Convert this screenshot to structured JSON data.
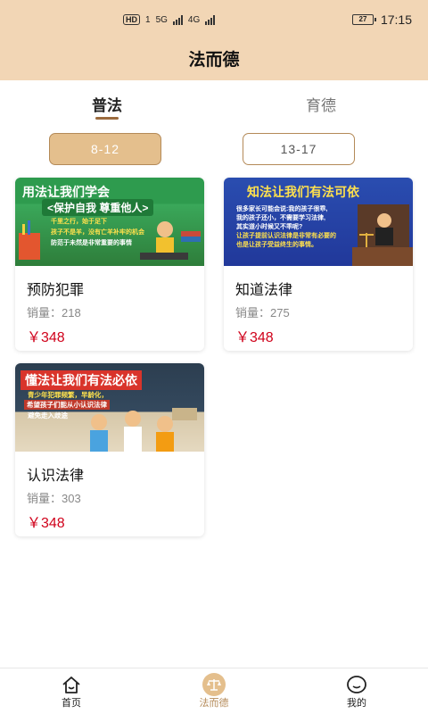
{
  "status": {
    "time": "17:15",
    "battery": "27",
    "hd": "HD",
    "sim": "1",
    "net1": "5G",
    "net2": "4G"
  },
  "header": {
    "title": "法而德"
  },
  "tabs": [
    {
      "label": "普法"
    },
    {
      "label": "育德"
    }
  ],
  "age_filters": [
    {
      "label": "8-12"
    },
    {
      "label": "13-17"
    }
  ],
  "products": [
    {
      "name": "预防犯罪",
      "sales": "销量：218",
      "price": "￥348",
      "banner": {
        "headline": "用法让我们学会",
        "line1": "<保护自我  尊重他人>",
        "line2": "千里之行，始于足下",
        "line3": "孩子不是羊，没有亡羊补牢的机会",
        "line4": "防范于未然是非常重要的事情"
      }
    },
    {
      "name": "知道法律",
      "sales": "销量：275",
      "price": "￥348",
      "banner": {
        "headline": "知法让我们有法可依",
        "line1": "很多家长可能会说:我的孩子很乖,",
        "line2": "我的孩子还小，不需要学习法律,",
        "line3": "其实道小时候又不乖呢?",
        "line4": "让孩子提前认识法律是非常有必要的",
        "line5": "也是让孩子受益终生的事情。"
      }
    },
    {
      "name": "认识法律",
      "sales": "销量：303",
      "price": "￥348",
      "banner": {
        "headline": "懂法让我们有法必依",
        "line1": "青少年犯罪频繁，早龄化，",
        "line2": "希望孩子们能从小认识法律",
        "line3": "避免走入歧途"
      }
    }
  ],
  "bottom_nav": [
    {
      "label": "首页"
    },
    {
      "label": "法而德"
    },
    {
      "label": "我的"
    }
  ]
}
